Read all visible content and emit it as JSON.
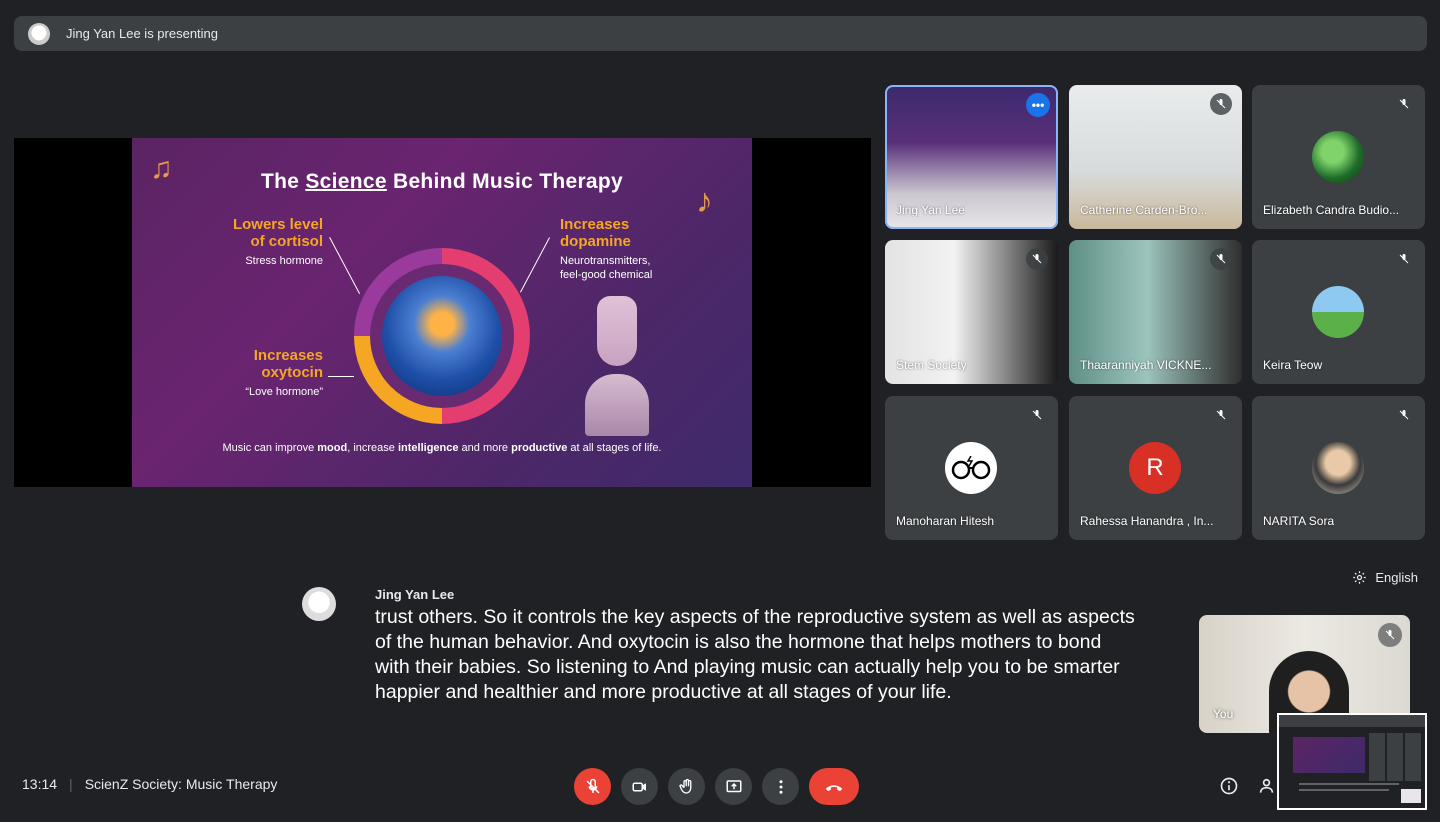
{
  "presenting_bar": {
    "text": "Jing Yan Lee is presenting"
  },
  "slide": {
    "title_pre": "The ",
    "title_underlined": "Science",
    "title_post": " Behind Music Therapy",
    "cortisol": {
      "heading_1": "Lowers level",
      "heading_2": "of cortisol",
      "sub": "Stress hormone"
    },
    "dopamine": {
      "heading_1": "Increases",
      "heading_2": "dopamine",
      "sub_1": "Neurotransmitters,",
      "sub_2": "feel-good chemical"
    },
    "oxytocin": {
      "heading_1": "Increases",
      "heading_2": "oxytocin",
      "sub": "“Love hormone”"
    },
    "footer": {
      "p1": "Music can improve ",
      "b1": "mood",
      "p2": ", increase ",
      "b2": "intelligence",
      "p3": " and more ",
      "b3": "productive",
      "p4": " at all stages of life."
    }
  },
  "participants": [
    {
      "name": "Jing Yan Lee"
    },
    {
      "name": "Catherine Carden-Bro..."
    },
    {
      "name": "Elizabeth Candra Budio..."
    },
    {
      "name": "Stem Society"
    },
    {
      "name": "Thaaranniyah VICKNE..."
    },
    {
      "name": "Keira Teow"
    },
    {
      "name": "Manoharan Hitesh"
    },
    {
      "name": "Rahessa Hanandra , In...",
      "initial": "R"
    },
    {
      "name": "NARITA Sora"
    }
  ],
  "caption": {
    "speaker": "Jing Yan Lee",
    "text": "trust others. So it controls the key aspects of the reproductive system as well as aspects of the human behavior. And oxytocin is also the hormone that helps mothers to bond with their babies. So listening to And playing music can actually help you to be smarter happier and healthier and more productive at all stages of your life."
  },
  "caption_language": "English",
  "self_view": {
    "name": "You"
  },
  "meeting": {
    "time": "13:14",
    "separator": "|",
    "title": "ScienZ Society: Music Therapy"
  },
  "colors": {
    "accent_blue": "#8ab4f8",
    "danger_red": "#ea4335",
    "surface": "#3c4043",
    "background": "#202124",
    "slide_orange": "#f5a623"
  },
  "icons": [
    "mic-off-icon",
    "camera-icon",
    "raise-hand-icon",
    "present-icon",
    "more-options-icon",
    "end-call-icon",
    "info-icon",
    "people-icon",
    "settings-gear-icon"
  ]
}
